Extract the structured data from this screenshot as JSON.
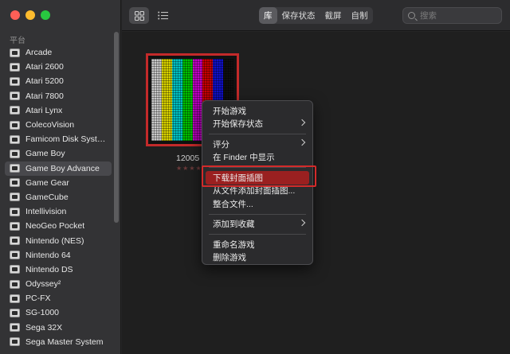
{
  "sidebar": {
    "section_title": "平台",
    "items": [
      {
        "label": "Arcade",
        "icon": "arcade-icon"
      },
      {
        "label": "Atari 2600",
        "icon": "atari-2600-icon"
      },
      {
        "label": "Atari 5200",
        "icon": "atari-5200-icon"
      },
      {
        "label": "Atari 7800",
        "icon": "atari-7800-icon"
      },
      {
        "label": "Atari Lynx",
        "icon": "atari-lynx-icon"
      },
      {
        "label": "ColecoVision",
        "icon": "colecovision-icon"
      },
      {
        "label": "Famicom Disk Syst…",
        "icon": "famicom-disk-icon"
      },
      {
        "label": "Game Boy",
        "icon": "game-boy-icon"
      },
      {
        "label": "Game Boy Advance",
        "icon": "game-boy-advance-icon",
        "selected": true
      },
      {
        "label": "Game Gear",
        "icon": "game-gear-icon"
      },
      {
        "label": "GameCube",
        "icon": "gamecube-icon"
      },
      {
        "label": "Intellivision",
        "icon": "intellivision-icon"
      },
      {
        "label": "NeoGeo Pocket",
        "icon": "neogeo-pocket-icon"
      },
      {
        "label": "Nintendo (NES)",
        "icon": "nes-icon"
      },
      {
        "label": "Nintendo 64",
        "icon": "n64-icon"
      },
      {
        "label": "Nintendo DS",
        "icon": "nds-icon"
      },
      {
        "label": "Odyssey²",
        "icon": "odyssey-icon"
      },
      {
        "label": "PC-FX",
        "icon": "pc-fx-icon"
      },
      {
        "label": "SG-1000",
        "icon": "sg-1000-icon"
      },
      {
        "label": "Sega 32X",
        "icon": "sega-32x-icon"
      },
      {
        "label": "Sega Master System",
        "icon": "sega-master-system-icon"
      }
    ]
  },
  "toolbar": {
    "view_grid_icon": "grid-view-icon",
    "view_list_icon": "list-view-icon",
    "tabs": [
      "库",
      "保存状态",
      "截屏",
      "自制"
    ],
    "active_tab": "库",
    "search_placeholder": "搜索"
  },
  "game": {
    "title": "12005",
    "rating_stars": "★★★★★",
    "cover_colors": [
      "#c9c9c9",
      "#d8d100",
      "#00c2c4",
      "#00c000",
      "#c000c4",
      "#c80000",
      "#1010c8",
      "#101010"
    ]
  },
  "context_menu": {
    "items": [
      {
        "label": "开始游戏",
        "submenu": false
      },
      {
        "label": "开始保存状态",
        "submenu": true
      },
      {
        "sep": true
      },
      {
        "label": "评分",
        "submenu": true
      },
      {
        "label": "在 Finder 中显示",
        "submenu": false
      },
      {
        "sep": true
      },
      {
        "label": "下载封面插图",
        "submenu": false,
        "highlighted": true
      },
      {
        "label": "从文件添加封面插图...",
        "submenu": false
      },
      {
        "label": "整合文件...",
        "submenu": false
      },
      {
        "sep": true
      },
      {
        "label": "添加到收藏",
        "submenu": true
      },
      {
        "sep": true
      },
      {
        "label": "重命名游戏",
        "submenu": false
      },
      {
        "label": "删除游戏",
        "submenu": false
      }
    ]
  },
  "colors": {
    "accent_highlight": "#9a2020",
    "selection_border": "#c32a2a"
  }
}
